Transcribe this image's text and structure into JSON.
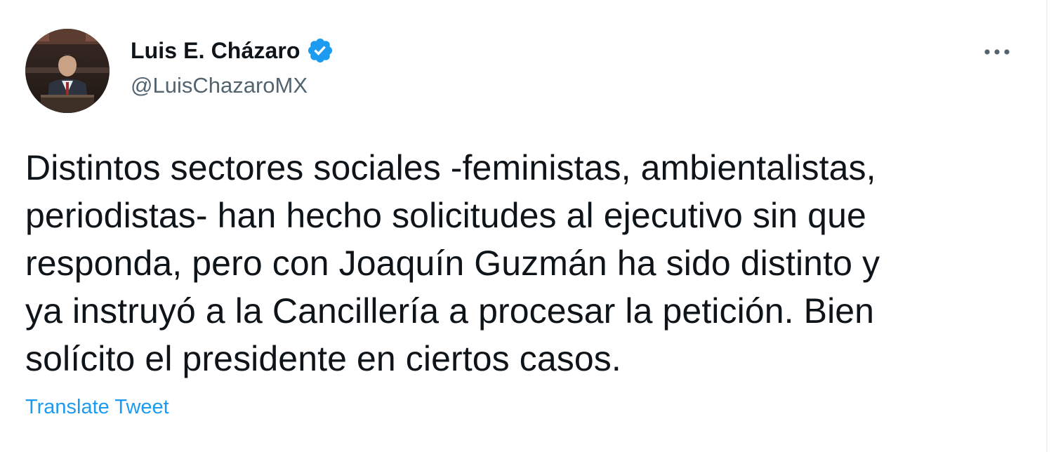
{
  "tweet": {
    "author": {
      "display_name": "Luis E. Cházaro",
      "handle": "@LuisChazaroMX",
      "verified": true,
      "verified_icon": "verified-badge-icon",
      "avatar": "profile-photo"
    },
    "more_icon": "more-horizontal-icon",
    "text_lines": [
      "Distintos sectores sociales -feministas, ambientalistas,",
      "periodistas- han hecho solicitudes al ejecutivo sin que",
      "responda, pero con Joaquín Guzmán ha sido distinto y",
      "ya instruyó a la Cancillería a procesar la petición. Bien",
      "solícito el presidente en ciertos casos."
    ],
    "translate_label": "Translate Tweet"
  },
  "colors": {
    "text_primary": "#0f1419",
    "text_secondary": "#536471",
    "accent": "#1d9bf0",
    "border": "#eff3f4"
  }
}
